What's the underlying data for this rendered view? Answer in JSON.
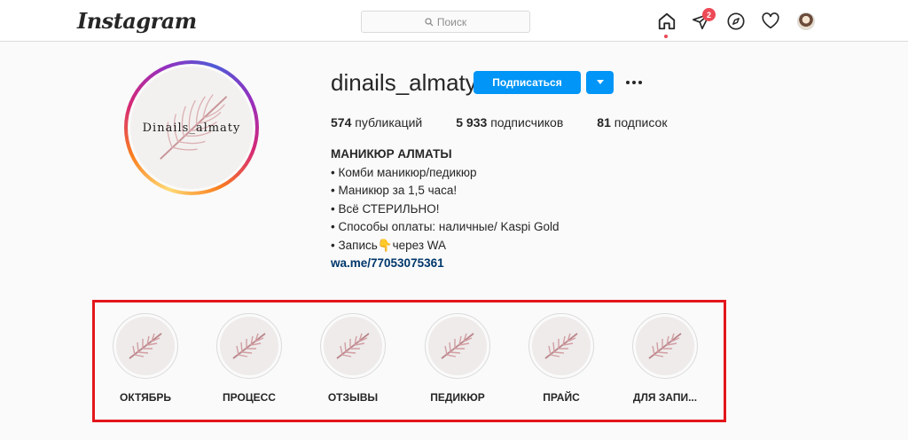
{
  "nav": {
    "logo": "Instagram",
    "search_placeholder": "Поиск",
    "notification_count": "2",
    "icons": [
      "home-icon",
      "direct-icon",
      "explore-icon",
      "heart-icon",
      "profile-avatar"
    ]
  },
  "profile": {
    "avatar_text": "Dinails_almaty",
    "username": "dinails_almaty",
    "follow_label": "Подписаться",
    "stats": [
      {
        "count": "574",
        "label": "публикаций"
      },
      {
        "count": "5 933",
        "label": "подписчиков"
      },
      {
        "count": "81",
        "label": "подписок"
      }
    ],
    "bio": {
      "name": "МАНИКЮР АЛМАТЫ",
      "lines": [
        "• Комби маникюр/педикюр",
        "• Маникюр за 1,5 часа!",
        "• Всё СТЕРИЛЬНО!",
        "• Способы оплаты: наличные/ Kaspi Gold",
        "• Запись👇через WA"
      ],
      "link": "wa.me/77053075361"
    }
  },
  "highlights": [
    {
      "label": "ОКТЯБРЬ"
    },
    {
      "label": "ПРОЦЕСС"
    },
    {
      "label": "ОТЗЫВЫ"
    },
    {
      "label": "ПЕДИКЮР"
    },
    {
      "label": "ПРАЙС"
    },
    {
      "label": "ДЛЯ ЗАПИ..."
    }
  ],
  "colors": {
    "accent": "#0095f6",
    "highlight_frame": "#e3161b",
    "notification": "#ed4956",
    "feather": "#d9a9ae"
  }
}
